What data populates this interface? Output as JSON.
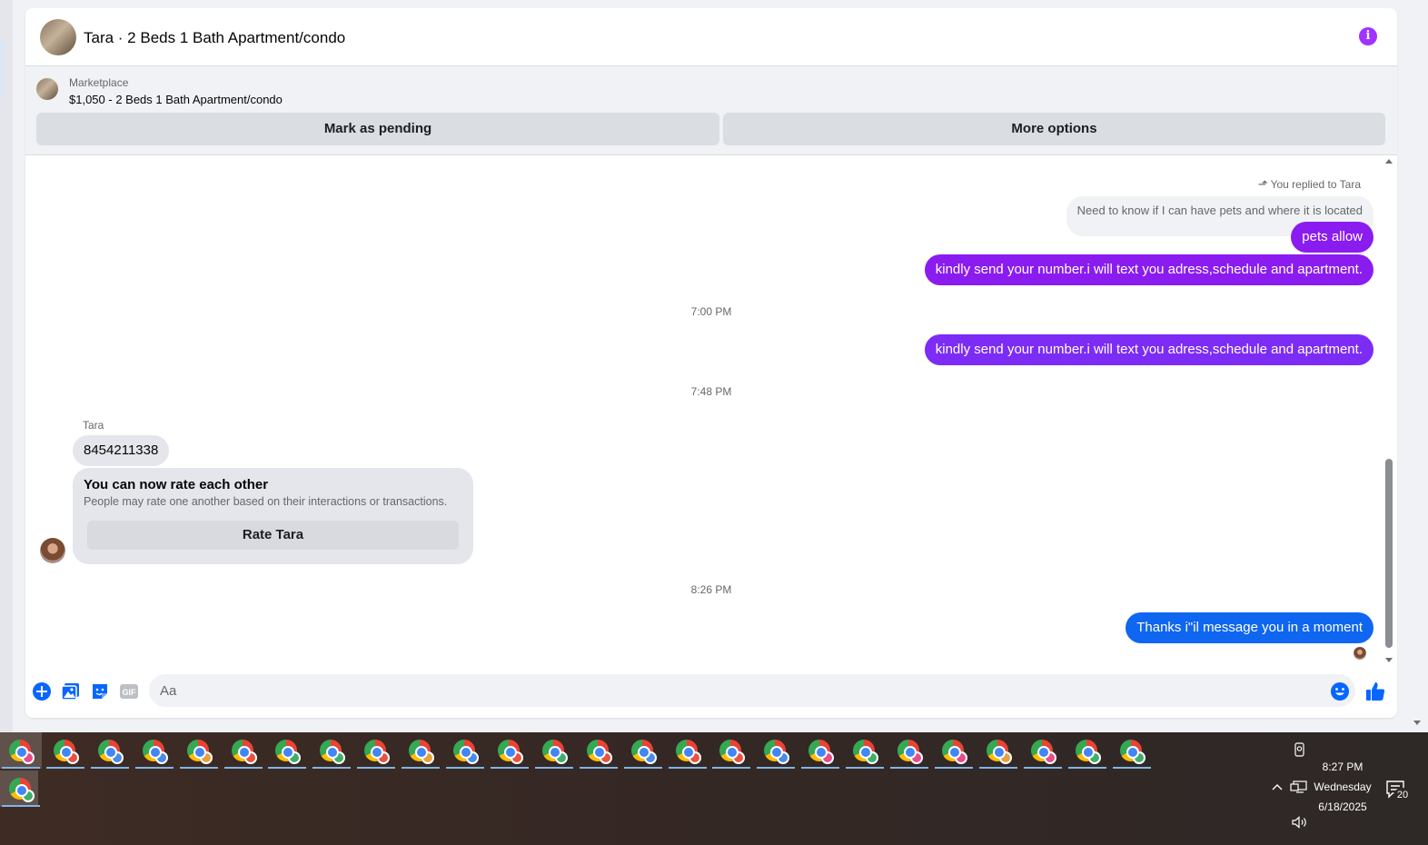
{
  "header": {
    "title": "Tara · 2 Beds 1 Bath Apartment/condo"
  },
  "marketplace": {
    "label": "Marketplace",
    "item": "$1,050 - 2 Beds 1 Bath Apartment/condo",
    "mark_pending_label": "Mark as pending",
    "more_options_label": "More options"
  },
  "thread": {
    "reply_label": "You replied to Tara",
    "quoted_text": "Need to know if I can have pets  and where it is located",
    "msg_pets_allow": "pets allow",
    "msg_send_number_1": "kindly send your number.i will text you adress,schedule and apartment.",
    "time_1": "7:00 PM",
    "msg_send_number_2": "kindly send your number.i will text you adress,schedule and apartment.",
    "time_2": "7:48 PM",
    "sender_name": "Tara",
    "msg_phone": "8454211338",
    "rate_title": "You can now rate each other",
    "rate_desc": "People may rate one another based on their interactions or transactions.",
    "rate_button": "Rate Tara",
    "time_3": "8:26 PM",
    "msg_thanks": "Thanks i\"il message you in a moment"
  },
  "composer": {
    "placeholder": "Aa"
  },
  "colors": {
    "accent_purple": "#8a1cf0",
    "accent_blue": "#0f66f0",
    "info_icon": "#a033ff"
  },
  "taskbar": {
    "clock_time": "8:27 PM",
    "clock_day": "Wednesday",
    "clock_date": "6/18/2025",
    "notification_count": "20",
    "app_icons": [
      "chrome-icon"
    ],
    "profile_colors": [
      "#e84b8a",
      "#e8533f",
      "#4a8be8",
      "#4a8be8",
      "#e8a03f",
      "#e8533f",
      "#3fae6a",
      "#3fae6a",
      "#e8533f",
      "#e8a03f",
      "#4a8be8",
      "#e8533f",
      "#3fae6a",
      "#e8533f",
      "#4a8be8",
      "#e8533f",
      "#e8533f",
      "#4a8be8",
      "#e84b8a",
      "#3fae6a",
      "#e84b8a",
      "#e84b8a",
      "#e8a03f",
      "#e84b8a",
      "#3fae6a",
      "#3fae6a"
    ]
  }
}
